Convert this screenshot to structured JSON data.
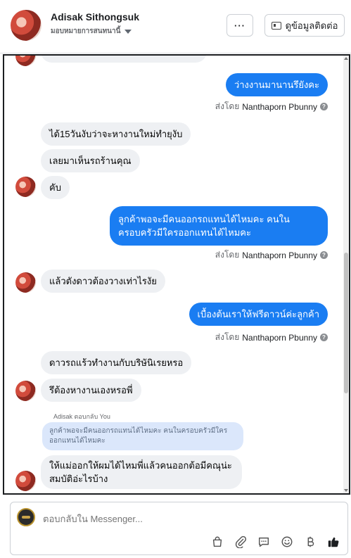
{
  "header": {
    "contact_name": "Adisak Sithongsuk",
    "assign_label": "มอบหมายการสนทนานี้",
    "more_label": "···",
    "contact_button_label": "ดูข้อมูลติดต่อ"
  },
  "chat": {
    "sent_by_prefix": "ส่งโดย",
    "agent_name": "Nanthaporn Pbunny",
    "messages": [
      {
        "text": "ว่างงานมานานรึยังคะ"
      },
      {
        "text": "ได้15วันงับว่าจะหางานใหม่ทำยุงับ"
      },
      {
        "text": "เลยมาเห็นรถร้านคุณ"
      },
      {
        "text": "คับ"
      },
      {
        "text": "ลูกค้าพอจะมีคนออกรถแทนได้ไหมคะ คนใน ครอบครัวมีใครออกแทนได้ไหมคะ"
      },
      {
        "text": "แล้วตังดาวต้องวางเท่าไรงัย"
      },
      {
        "text": "เบื้องต้นเราให้ฟรีดาวน์ค่ะลูกค้า"
      },
      {
        "text": "ดาวรถแร้วทำงานกับบริษันิเรยหรอ"
      },
      {
        "text": "รึต้องหางานเองหรอพี่"
      },
      {
        "text": "ให้แม่ออกให้ผมได้ไหมพี่แล้วคนออกต้อมีคณุน่ะสมบัติอ่ะไรบ้าง"
      }
    ],
    "reply_label": "Adisak ตอบกลับ You",
    "reply_quote": "ลูกค้าพอจะมีคนออกรถแทนได้ไหมคะ คนในครอบครัวมีใครออกแทนได้ไหมคะ"
  },
  "composer": {
    "placeholder": "ตอบกลับใน Messenger..."
  },
  "icons": [
    "ellipsis-icon",
    "contact-card-icon",
    "info-icon",
    "bag-icon",
    "paperclip-icon",
    "saved-reply-icon",
    "emoji-icon",
    "baht-icon",
    "thumbs-up-icon"
  ],
  "colors": {
    "outgoing": "#1a7df2",
    "incoming": "#eef0f3"
  }
}
